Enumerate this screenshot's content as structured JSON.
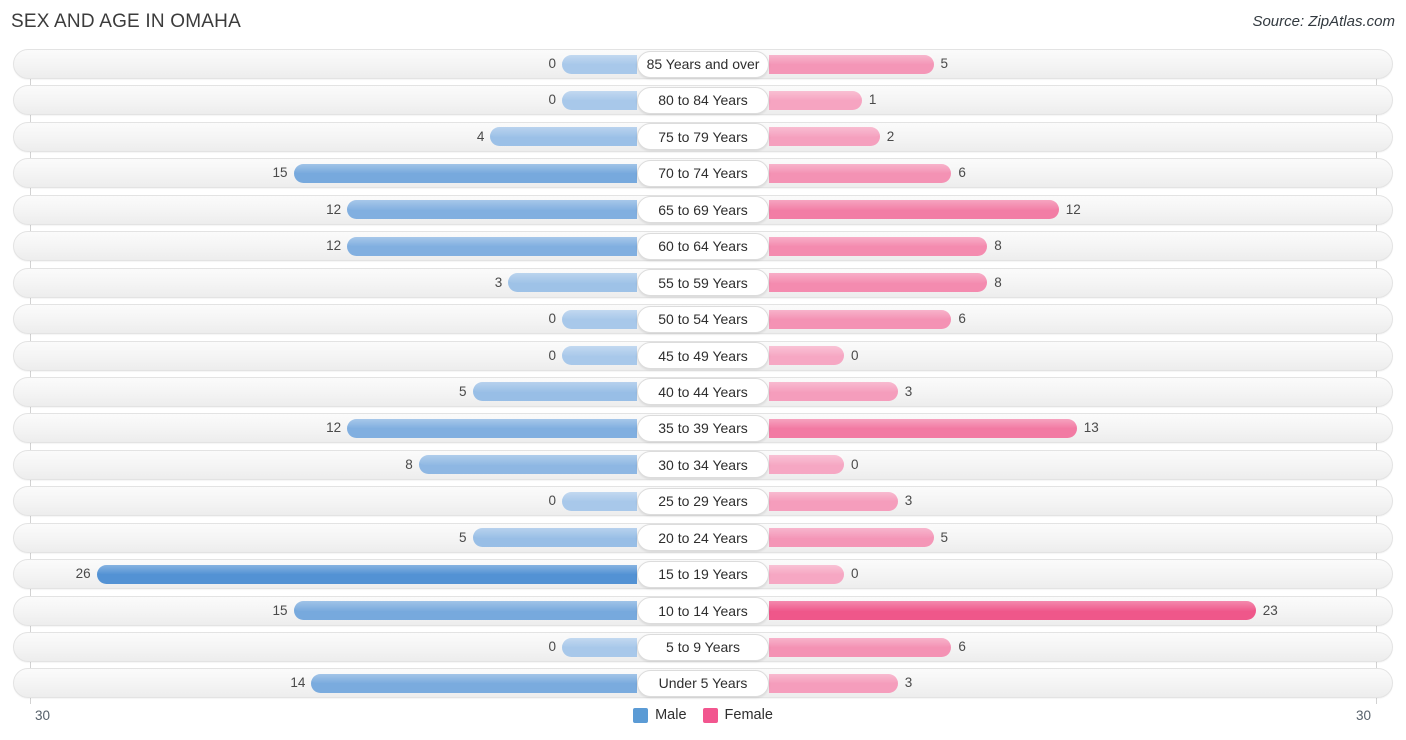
{
  "header": {
    "title": "SEX AND AGE IN OMAHA",
    "source": "Source: ZipAtlas.com"
  },
  "legend": {
    "male_label": "Male",
    "female_label": "Female",
    "male_color": "#5b9bd5",
    "female_color": "#f2568f"
  },
  "axis": {
    "left_max_label": "30",
    "right_max_label": "30",
    "max": 30
  },
  "chart_data": {
    "type": "bar",
    "title": "SEX AND AGE IN OMAHA",
    "subtitle": "Source: ZipAtlas.com",
    "orientation": "horizontal-diverging",
    "xlabel": "",
    "ylabel": "",
    "xlim": [
      30,
      30
    ],
    "grid": true,
    "legend_position": "bottom-center",
    "categories": [
      "85 Years and over",
      "80 to 84 Years",
      "75 to 79 Years",
      "70 to 74 Years",
      "65 to 69 Years",
      "60 to 64 Years",
      "55 to 59 Years",
      "50 to 54 Years",
      "45 to 49 Years",
      "40 to 44 Years",
      "35 to 39 Years",
      "30 to 34 Years",
      "25 to 29 Years",
      "20 to 24 Years",
      "15 to 19 Years",
      "10 to 14 Years",
      "5 to 9 Years",
      "Under 5 Years"
    ],
    "series": [
      {
        "name": "Male",
        "color": "#5b9bd5",
        "values": [
          0,
          0,
          4,
          15,
          12,
          12,
          3,
          0,
          0,
          5,
          12,
          8,
          0,
          5,
          26,
          15,
          0,
          14
        ]
      },
      {
        "name": "Female",
        "color": "#f2568f",
        "values": [
          5,
          1,
          2,
          6,
          12,
          8,
          8,
          6,
          0,
          3,
          13,
          0,
          3,
          5,
          0,
          23,
          6,
          3
        ]
      }
    ]
  },
  "rows": [
    {
      "age": "85 Years and over",
      "male": "0",
      "female": "5",
      "male_v": 0,
      "female_v": 5
    },
    {
      "age": "80 to 84 Years",
      "male": "0",
      "female": "1",
      "male_v": 0,
      "female_v": 1
    },
    {
      "age": "75 to 79 Years",
      "male": "4",
      "female": "2",
      "male_v": 4,
      "female_v": 2
    },
    {
      "age": "70 to 74 Years",
      "male": "15",
      "female": "6",
      "male_v": 15,
      "female_v": 6
    },
    {
      "age": "65 to 69 Years",
      "male": "12",
      "female": "12",
      "male_v": 12,
      "female_v": 12
    },
    {
      "age": "60 to 64 Years",
      "male": "12",
      "female": "8",
      "male_v": 12,
      "female_v": 8
    },
    {
      "age": "55 to 59 Years",
      "male": "3",
      "female": "8",
      "male_v": 3,
      "female_v": 8
    },
    {
      "age": "50 to 54 Years",
      "male": "0",
      "female": "6",
      "male_v": 0,
      "female_v": 6
    },
    {
      "age": "45 to 49 Years",
      "male": "0",
      "female": "0",
      "male_v": 0,
      "female_v": 0
    },
    {
      "age": "40 to 44 Years",
      "male": "5",
      "female": "3",
      "male_v": 5,
      "female_v": 3
    },
    {
      "age": "35 to 39 Years",
      "male": "12",
      "female": "13",
      "male_v": 12,
      "female_v": 13
    },
    {
      "age": "30 to 34 Years",
      "male": "8",
      "female": "0",
      "male_v": 8,
      "female_v": 0
    },
    {
      "age": "25 to 29 Years",
      "male": "0",
      "female": "3",
      "male_v": 0,
      "female_v": 3
    },
    {
      "age": "20 to 24 Years",
      "male": "5",
      "female": "5",
      "male_v": 5,
      "female_v": 5
    },
    {
      "age": "15 to 19 Years",
      "male": "26",
      "female": "0",
      "male_v": 26,
      "female_v": 0
    },
    {
      "age": "10 to 14 Years",
      "male": "15",
      "female": "23",
      "male_v": 15,
      "female_v": 23
    },
    {
      "age": "5 to 9 Years",
      "male": "0",
      "female": "6",
      "male_v": 0,
      "female_v": 6
    },
    {
      "age": "Under 5 Years",
      "male": "14",
      "female": "3",
      "male_v": 14,
      "female_v": 3
    }
  ]
}
